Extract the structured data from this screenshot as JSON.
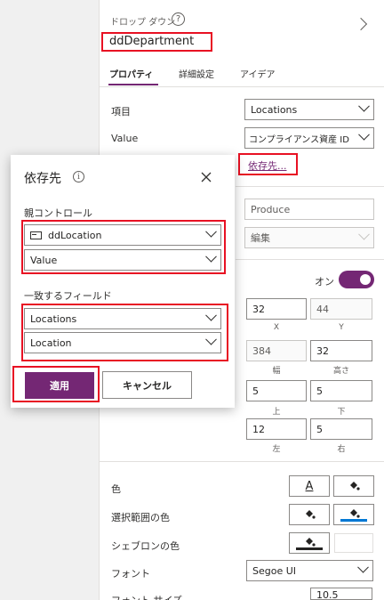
{
  "header": {
    "type_label": "ドロップ ダウン",
    "control_name": "ddDepartment"
  },
  "tabs": [
    {
      "label": "プロパティ"
    },
    {
      "label": "詳細設定"
    },
    {
      "label": "アイデア"
    }
  ],
  "properties": {
    "items_label": "項目",
    "items_value": "Locations",
    "value_label": "Value",
    "value_value": "コンプライアンス資産 ID",
    "depends_link": "依存先...",
    "default_value": "Produce",
    "edit_placeholder": "編集",
    "toggle_label": "オン",
    "x_value": "32",
    "y_value": "44",
    "x_label": "X",
    "y_label": "Y",
    "width_value": "384",
    "height_value": "32",
    "width_label": "幅",
    "height_label": "高さ",
    "top_value": "5",
    "bottom_value": "5",
    "top_label": "上",
    "bottom_label": "下",
    "left_value": "12",
    "right_value": "5",
    "left_label": "左",
    "right_label": "右",
    "color_label": "色",
    "selection_color_label": "選択範囲の色",
    "chevron_color_label": "シェブロンの色",
    "font_label": "フォント",
    "font_value": "Segoe UI",
    "font_size_label": "フォント サイズ",
    "font_size_value": "10.5",
    "text_color_glyph": "A"
  },
  "dialog": {
    "title": "依存先",
    "parent_control_label": "親コントロール",
    "parent_control_value": "ddLocation",
    "parent_field_value": "Value",
    "match_field_label": "一致するフィールド",
    "match_table_value": "Locations",
    "match_field_value": "Location",
    "apply_button": "適用",
    "cancel_button": "キャンセル"
  },
  "colors": {
    "accent": "#742774",
    "link": "#742774",
    "highlight": "#e81123",
    "selection_bar": "#0078d4"
  }
}
